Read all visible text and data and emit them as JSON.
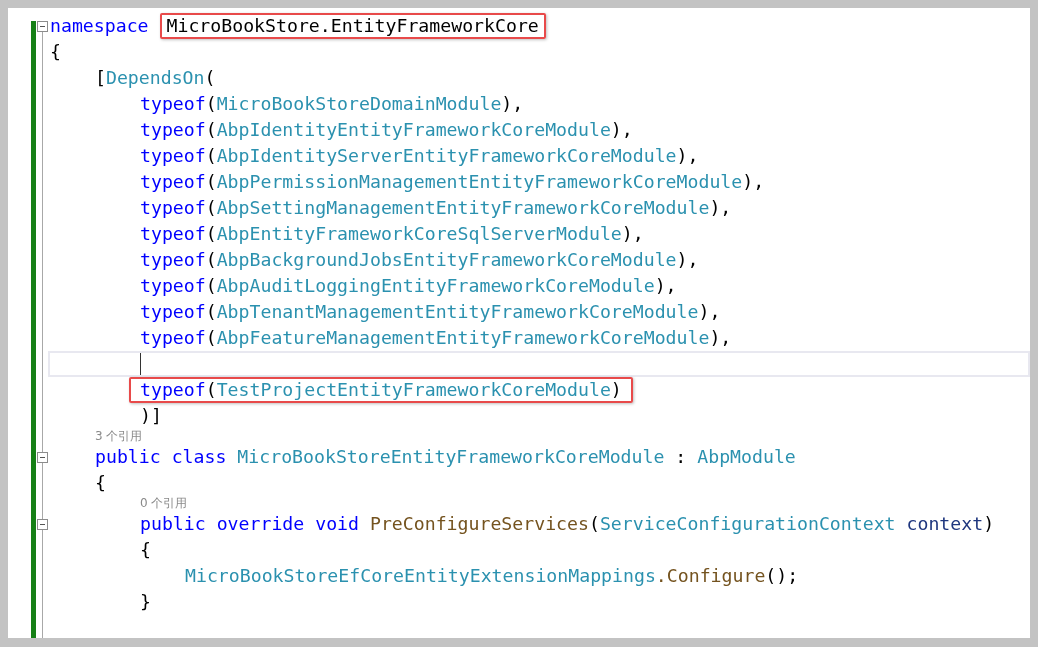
{
  "code_lines": [
    {
      "kind": "code",
      "expanded": true,
      "tokens": [
        {
          "text": "namespace ",
          "kind": "keyword"
        },
        {
          "text": "MicroBookStore.EntityFrameworkCore",
          "kind": "plain",
          "boxed": true
        }
      ]
    },
    {
      "kind": "code",
      "tokens": [
        {
          "text": "{",
          "kind": "plain"
        }
      ]
    },
    {
      "kind": "block",
      "children": [
        {
          "kind": "code",
          "tokens": [
            {
              "text": "[",
              "kind": "plain"
            },
            {
              "text": "DependsOn",
              "kind": "type"
            },
            {
              "text": "(",
              "kind": "plain"
            }
          ]
        },
        {
          "kind": "block",
          "children": [
            {
              "kind": "code",
              "tokens": [
                {
                  "text": "typeof",
                  "kind": "keyword"
                },
                {
                  "text": "(",
                  "kind": "plain"
                },
                {
                  "text": "MicroBookStoreDomainModule",
                  "kind": "type"
                },
                {
                  "text": "),",
                  "kind": "plain"
                }
              ]
            },
            {
              "kind": "code",
              "tokens": [
                {
                  "text": "typeof",
                  "kind": "keyword"
                },
                {
                  "text": "(",
                  "kind": "plain"
                },
                {
                  "text": "AbpIdentityEntityFrameworkCoreModule",
                  "kind": "type"
                },
                {
                  "text": "),",
                  "kind": "plain"
                }
              ]
            },
            {
              "kind": "code",
              "tokens": [
                {
                  "text": "typeof",
                  "kind": "keyword"
                },
                {
                  "text": "(",
                  "kind": "plain"
                },
                {
                  "text": "AbpIdentityServerEntityFrameworkCoreModule",
                  "kind": "type"
                },
                {
                  "text": "),",
                  "kind": "plain"
                }
              ]
            },
            {
              "kind": "code",
              "tokens": [
                {
                  "text": "typeof",
                  "kind": "keyword"
                },
                {
                  "text": "(",
                  "kind": "plain"
                },
                {
                  "text": "AbpPermissionManagementEntityFrameworkCoreModule",
                  "kind": "type"
                },
                {
                  "text": "),",
                  "kind": "plain"
                }
              ]
            },
            {
              "kind": "code",
              "tokens": [
                {
                  "text": "typeof",
                  "kind": "keyword"
                },
                {
                  "text": "(",
                  "kind": "plain"
                },
                {
                  "text": "AbpSettingManagementEntityFrameworkCoreModule",
                  "kind": "type"
                },
                {
                  "text": "),",
                  "kind": "plain"
                }
              ]
            },
            {
              "kind": "code",
              "tokens": [
                {
                  "text": "typeof",
                  "kind": "keyword"
                },
                {
                  "text": "(",
                  "kind": "plain"
                },
                {
                  "text": "AbpEntityFrameworkCoreSqlServerModule",
                  "kind": "type"
                },
                {
                  "text": "),",
                  "kind": "plain"
                }
              ]
            },
            {
              "kind": "code",
              "tokens": [
                {
                  "text": "typeof",
                  "kind": "keyword"
                },
                {
                  "text": "(",
                  "kind": "plain"
                },
                {
                  "text": "AbpBackgroundJobsEntityFrameworkCoreModule",
                  "kind": "type"
                },
                {
                  "text": "),",
                  "kind": "plain"
                }
              ]
            },
            {
              "kind": "code",
              "tokens": [
                {
                  "text": "typeof",
                  "kind": "keyword"
                },
                {
                  "text": "(",
                  "kind": "plain"
                },
                {
                  "text": "AbpAuditLoggingEntityFrameworkCoreModule",
                  "kind": "type"
                },
                {
                  "text": "),",
                  "kind": "plain"
                }
              ]
            },
            {
              "kind": "code",
              "tokens": [
                {
                  "text": "typeof",
                  "kind": "keyword"
                },
                {
                  "text": "(",
                  "kind": "plain"
                },
                {
                  "text": "AbpTenantManagementEntityFrameworkCoreModule",
                  "kind": "type"
                },
                {
                  "text": "),",
                  "kind": "plain"
                }
              ]
            },
            {
              "kind": "code",
              "tokens": [
                {
                  "text": "typeof",
                  "kind": "keyword"
                },
                {
                  "text": "(",
                  "kind": "plain"
                },
                {
                  "text": "AbpFeatureManagementEntityFrameworkCoreModule",
                  "kind": "type"
                },
                {
                  "text": "),",
                  "kind": "plain"
                }
              ]
            },
            {
              "kind": "code",
              "current": true
            },
            {
              "kind": "code",
              "boxed": true,
              "tokens": [
                {
                  "text": "typeof",
                  "kind": "keyword"
                },
                {
                  "text": "(",
                  "kind": "plain"
                },
                {
                  "text": "TestProjectEntityFrameworkCoreModule",
                  "kind": "type"
                },
                {
                  "text": ")",
                  "kind": "plain"
                }
              ]
            },
            {
              "kind": "code",
              "tokens": [
                {
                  "text": ")]",
                  "kind": "plain"
                }
              ]
            }
          ]
        },
        {
          "kind": "codelens",
          "text": "3 个引用"
        },
        {
          "kind": "code",
          "expanded": true,
          "tokens": [
            {
              "text": "public class ",
              "kind": "keyword"
            },
            {
              "text": "MicroBookStoreEntityFrameworkCoreModule",
              "kind": "type"
            },
            {
              "text": " : ",
              "kind": "plain"
            },
            {
              "text": "AbpModule",
              "kind": "type"
            }
          ]
        },
        {
          "kind": "code",
          "tokens": [
            {
              "text": "{",
              "kind": "plain"
            }
          ]
        },
        {
          "kind": "block",
          "children": [
            {
              "kind": "codelens",
              "text": "0 个引用"
            },
            {
              "kind": "code",
              "expanded": true,
              "tokens": [
                {
                  "text": "public override void ",
                  "kind": "keyword"
                },
                {
                  "text": "PreConfigureServices",
                  "kind": "method"
                },
                {
                  "text": "(",
                  "kind": "plain"
                },
                {
                  "text": "ServiceConfigurationContext ",
                  "kind": "type"
                },
                {
                  "text": "context",
                  "kind": "parameter"
                },
                {
                  "text": ")",
                  "kind": "plain"
                }
              ]
            },
            {
              "kind": "code",
              "tokens": [
                {
                  "text": "{",
                  "kind": "plain"
                }
              ]
            },
            {
              "kind": "block",
              "children": [
                {
                  "kind": "code",
                  "tokens": [
                    {
                      "text": "MicroBookStoreEfCoreEntityExtensionMappings",
                      "kind": "type"
                    },
                    {
                      "text": ".Configure",
                      "kind": "method"
                    },
                    {
                      "text": "();",
                      "kind": "plain"
                    }
                  ]
                }
              ]
            },
            {
              "kind": "code",
              "tokens": [
                {
                  "text": "}",
                  "kind": "plain"
                }
              ]
            }
          ]
        }
      ]
    }
  ]
}
